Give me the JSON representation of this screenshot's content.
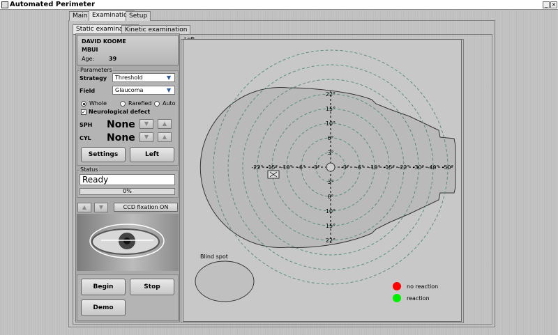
{
  "window": {
    "title": "Automated Perimeter"
  },
  "tabs": [
    {
      "label": "Main",
      "active": false
    },
    {
      "label": "Examination",
      "active": true
    },
    {
      "label": "Setup",
      "active": false
    }
  ],
  "subtabs": [
    {
      "label": "Static examination",
      "active": true
    },
    {
      "label": "Kinetic examination",
      "active": false
    }
  ],
  "patient": {
    "first_name": "DAVID KOOME",
    "last_name": "MBUI",
    "age_label": "Age:",
    "age": "39"
  },
  "parameters": {
    "title": "Parameters",
    "strategy_label": "Strategy",
    "strategy_value": "Threshold",
    "field_label": "Field",
    "field_value": "Glaucoma",
    "radio_options": [
      {
        "label": "Whole",
        "selected": true
      },
      {
        "label": "Rarefied",
        "selected": false
      },
      {
        "label": "Auto",
        "selected": false
      }
    ],
    "neuro_label": "Neurological defect",
    "neuro_checked": true,
    "sph_label": "SPH",
    "sph_value": "None",
    "cyl_label": "CYL",
    "cyl_value": "None",
    "settings_btn": "Settings",
    "eye_btn": "Left"
  },
  "status": {
    "title": "Status",
    "text": "Ready",
    "progress_label": "0%",
    "progress": 0
  },
  "camera": {
    "fixation_btn": "CCD fixation ON"
  },
  "actions": {
    "begin": "Begin",
    "stop": "Stop",
    "demo": "Demo"
  },
  "perimetry": {
    "eye_label": "Left",
    "ring_degrees": [
      3,
      6,
      10,
      15,
      22
    ],
    "dashed_ring_degrees": [
      3,
      6,
      10,
      15,
      22,
      30,
      40,
      50
    ],
    "y_ticks_up": [
      "22°",
      "15°",
      "10°",
      "6°",
      "3°"
    ],
    "y_ticks_down": [
      "3°",
      "6°",
      "10°",
      "15°",
      "22°"
    ],
    "x_ticks_left": [
      "22°",
      "15°",
      "10°",
      "6°",
      "3°"
    ],
    "x_ticks_right": [
      "3°",
      "6°",
      "10°",
      "15°",
      "22°",
      "30°",
      "40°",
      "50°"
    ],
    "blind_spot_label": "Blind spot",
    "legend": [
      {
        "label": "no reaction",
        "color": "#ff0000"
      },
      {
        "label": "reaction",
        "color": "#00ee00"
      }
    ]
  }
}
